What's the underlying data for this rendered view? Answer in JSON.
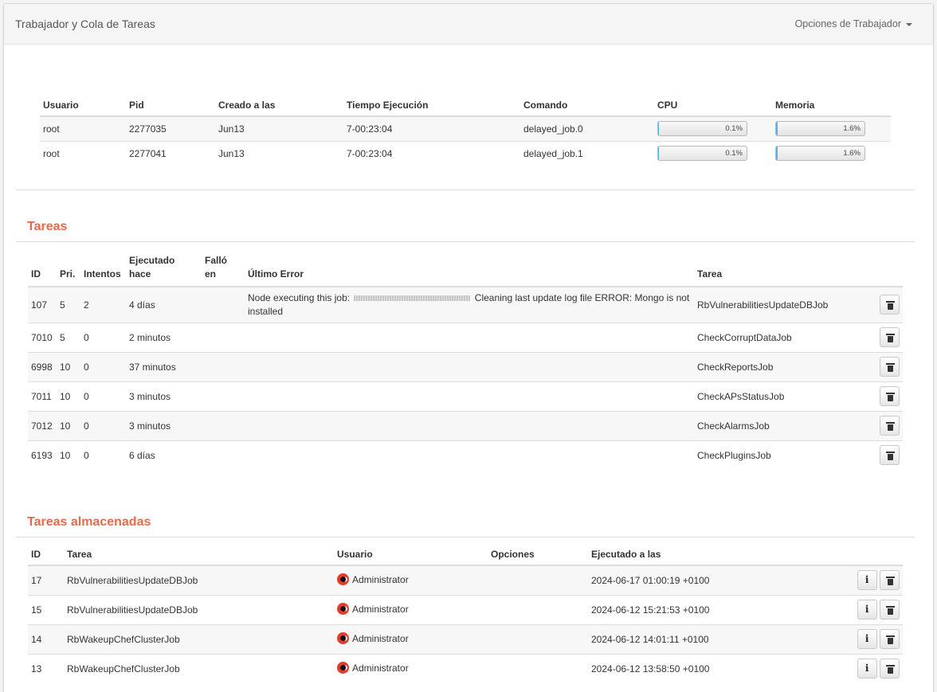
{
  "header": {
    "title": "Trabajador y Cola de Tareas",
    "options_label": "Opciones de Trabajador"
  },
  "workers": {
    "columns": [
      "Usuario",
      "Pid",
      "Creado a las",
      "Tiempo Ejecución",
      "Comando",
      "CPU",
      "Memoria"
    ],
    "rows": [
      {
        "user": "root",
        "pid": "2277035",
        "created": "Jun13",
        "runtime": "7-00:23:04",
        "command": "delayed_job.0",
        "cpu": "0.1%",
        "cpu_value": 0.1,
        "memory": "1.6%",
        "memory_value": 1.6
      },
      {
        "user": "root",
        "pid": "2277041",
        "created": "Jun13",
        "runtime": "7-00:23:04",
        "command": "delayed_job.1",
        "cpu": "0.1%",
        "cpu_value": 0.1,
        "memory": "1.6%",
        "memory_value": 1.6
      }
    ]
  },
  "tasks": {
    "title": "Tareas",
    "columns": {
      "id": "ID",
      "pri": "Pri.",
      "attempts": "Intentos",
      "executed_a": "Ejecutado",
      "executed_b": "hace",
      "failed_a": "Falló",
      "failed_b": "en",
      "last_error": "Último Error",
      "task": "Tarea"
    },
    "rows": [
      {
        "id": "107",
        "pri": "5",
        "attempts": "2",
        "executed": "4 días",
        "failed": "",
        "error_prefix": "Node executing this job:",
        "error_suffix": "Cleaning last update log file ERROR: Mongo is not installed",
        "task": "RbVulnerabilitiesUpdateDBJob"
      },
      {
        "id": "7010",
        "pri": "5",
        "attempts": "0",
        "executed": "2 minutos",
        "failed": "",
        "error_prefix": "",
        "error_suffix": "",
        "task": "CheckCorruptDataJob"
      },
      {
        "id": "6998",
        "pri": "10",
        "attempts": "0",
        "executed": "37 minutos",
        "failed": "",
        "error_prefix": "",
        "error_suffix": "",
        "task": "CheckReportsJob"
      },
      {
        "id": "7011",
        "pri": "10",
        "attempts": "0",
        "executed": "3 minutos",
        "failed": "",
        "error_prefix": "",
        "error_suffix": "",
        "task": "CheckAPsStatusJob"
      },
      {
        "id": "7012",
        "pri": "10",
        "attempts": "0",
        "executed": "3 minutos",
        "failed": "",
        "error_prefix": "",
        "error_suffix": "",
        "task": "CheckAlarmsJob"
      },
      {
        "id": "6193",
        "pri": "10",
        "attempts": "0",
        "executed": "6 días",
        "failed": "",
        "error_prefix": "",
        "error_suffix": "",
        "task": "CheckPluginsJob"
      }
    ]
  },
  "stored": {
    "title": "Tareas almacenadas",
    "columns": [
      "ID",
      "Tarea",
      "Usuario",
      "Opciones",
      "Ejecutado a las"
    ],
    "rows": [
      {
        "id": "17",
        "task": "RbVulnerabilitiesUpdateDBJob",
        "user": "Administrator",
        "options": "",
        "executed_at": "2024-06-17 01:00:19 +0100"
      },
      {
        "id": "15",
        "task": "RbVulnerabilitiesUpdateDBJob",
        "user": "Administrator",
        "options": "",
        "executed_at": "2024-06-12 15:21:53 +0100"
      },
      {
        "id": "14",
        "task": "RbWakeupChefClusterJob",
        "user": "Administrator",
        "options": "",
        "executed_at": "2024-06-12 14:01:11 +0100"
      },
      {
        "id": "13",
        "task": "RbWakeupChefClusterJob",
        "user": "Administrator",
        "options": "",
        "executed_at": "2024-06-12 13:58:50 +0100"
      }
    ]
  },
  "icons": {
    "delete": "trash-icon",
    "info": "info-icon",
    "user": "user-avatar-icon",
    "options_caret": "caret-down-icon"
  },
  "colors": {
    "section_title": "#e8694a",
    "progress_fill": "#5bb0dd",
    "user_icon": "#e53b2c"
  }
}
